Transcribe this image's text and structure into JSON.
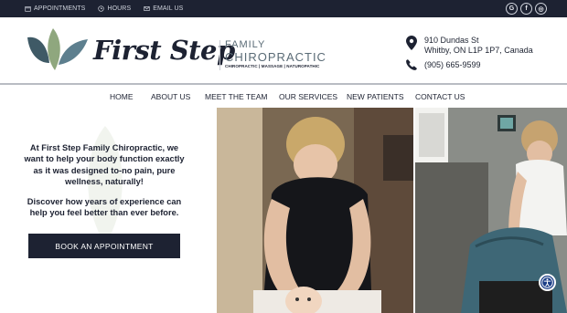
{
  "topbar": {
    "links": [
      {
        "label": "APPOINTMENTS",
        "icon": "calendar-icon"
      },
      {
        "label": "HOURS",
        "icon": "clock-icon"
      },
      {
        "label": "EMAIL US",
        "icon": "envelope-icon"
      }
    ],
    "social": [
      {
        "glyph": "G",
        "icon": "google-icon"
      },
      {
        "glyph": "f",
        "icon": "facebook-icon"
      },
      {
        "glyph": "◎",
        "icon": "instagram-icon"
      }
    ]
  },
  "brand": {
    "name": "First Step",
    "sub1": "FAMILY",
    "sub2": "CHIROPRACTIC",
    "tagline": "CHIROPRACTIC | MASSAGE | NATUROPATHIC"
  },
  "contact": {
    "address_line1": "910 Dundas St",
    "address_line2": "Whitby, ON L1P 1P7, Canada",
    "phone": "(905) 665-9599"
  },
  "nav": [
    "HOME",
    "ABOUT US",
    "MEET THE TEAM",
    "OUR SERVICES",
    "NEW PATIENTS",
    "CONTACT US"
  ],
  "hero": {
    "intro": "At First Step Family Chiropractic, we want to help your body function exactly as it was designed to-no pain, pure wellness, naturally!",
    "sub": "Discover how years of experience can help you feel better than ever before.",
    "cta": "BOOK AN APPOINTMENT"
  },
  "colors": {
    "navy": "#1d2232",
    "leaf_dark": "#3f5a66",
    "leaf_sage": "#8fa77e",
    "leaf_blue": "#5d7f8e",
    "accessibility": "#1c3f88"
  }
}
